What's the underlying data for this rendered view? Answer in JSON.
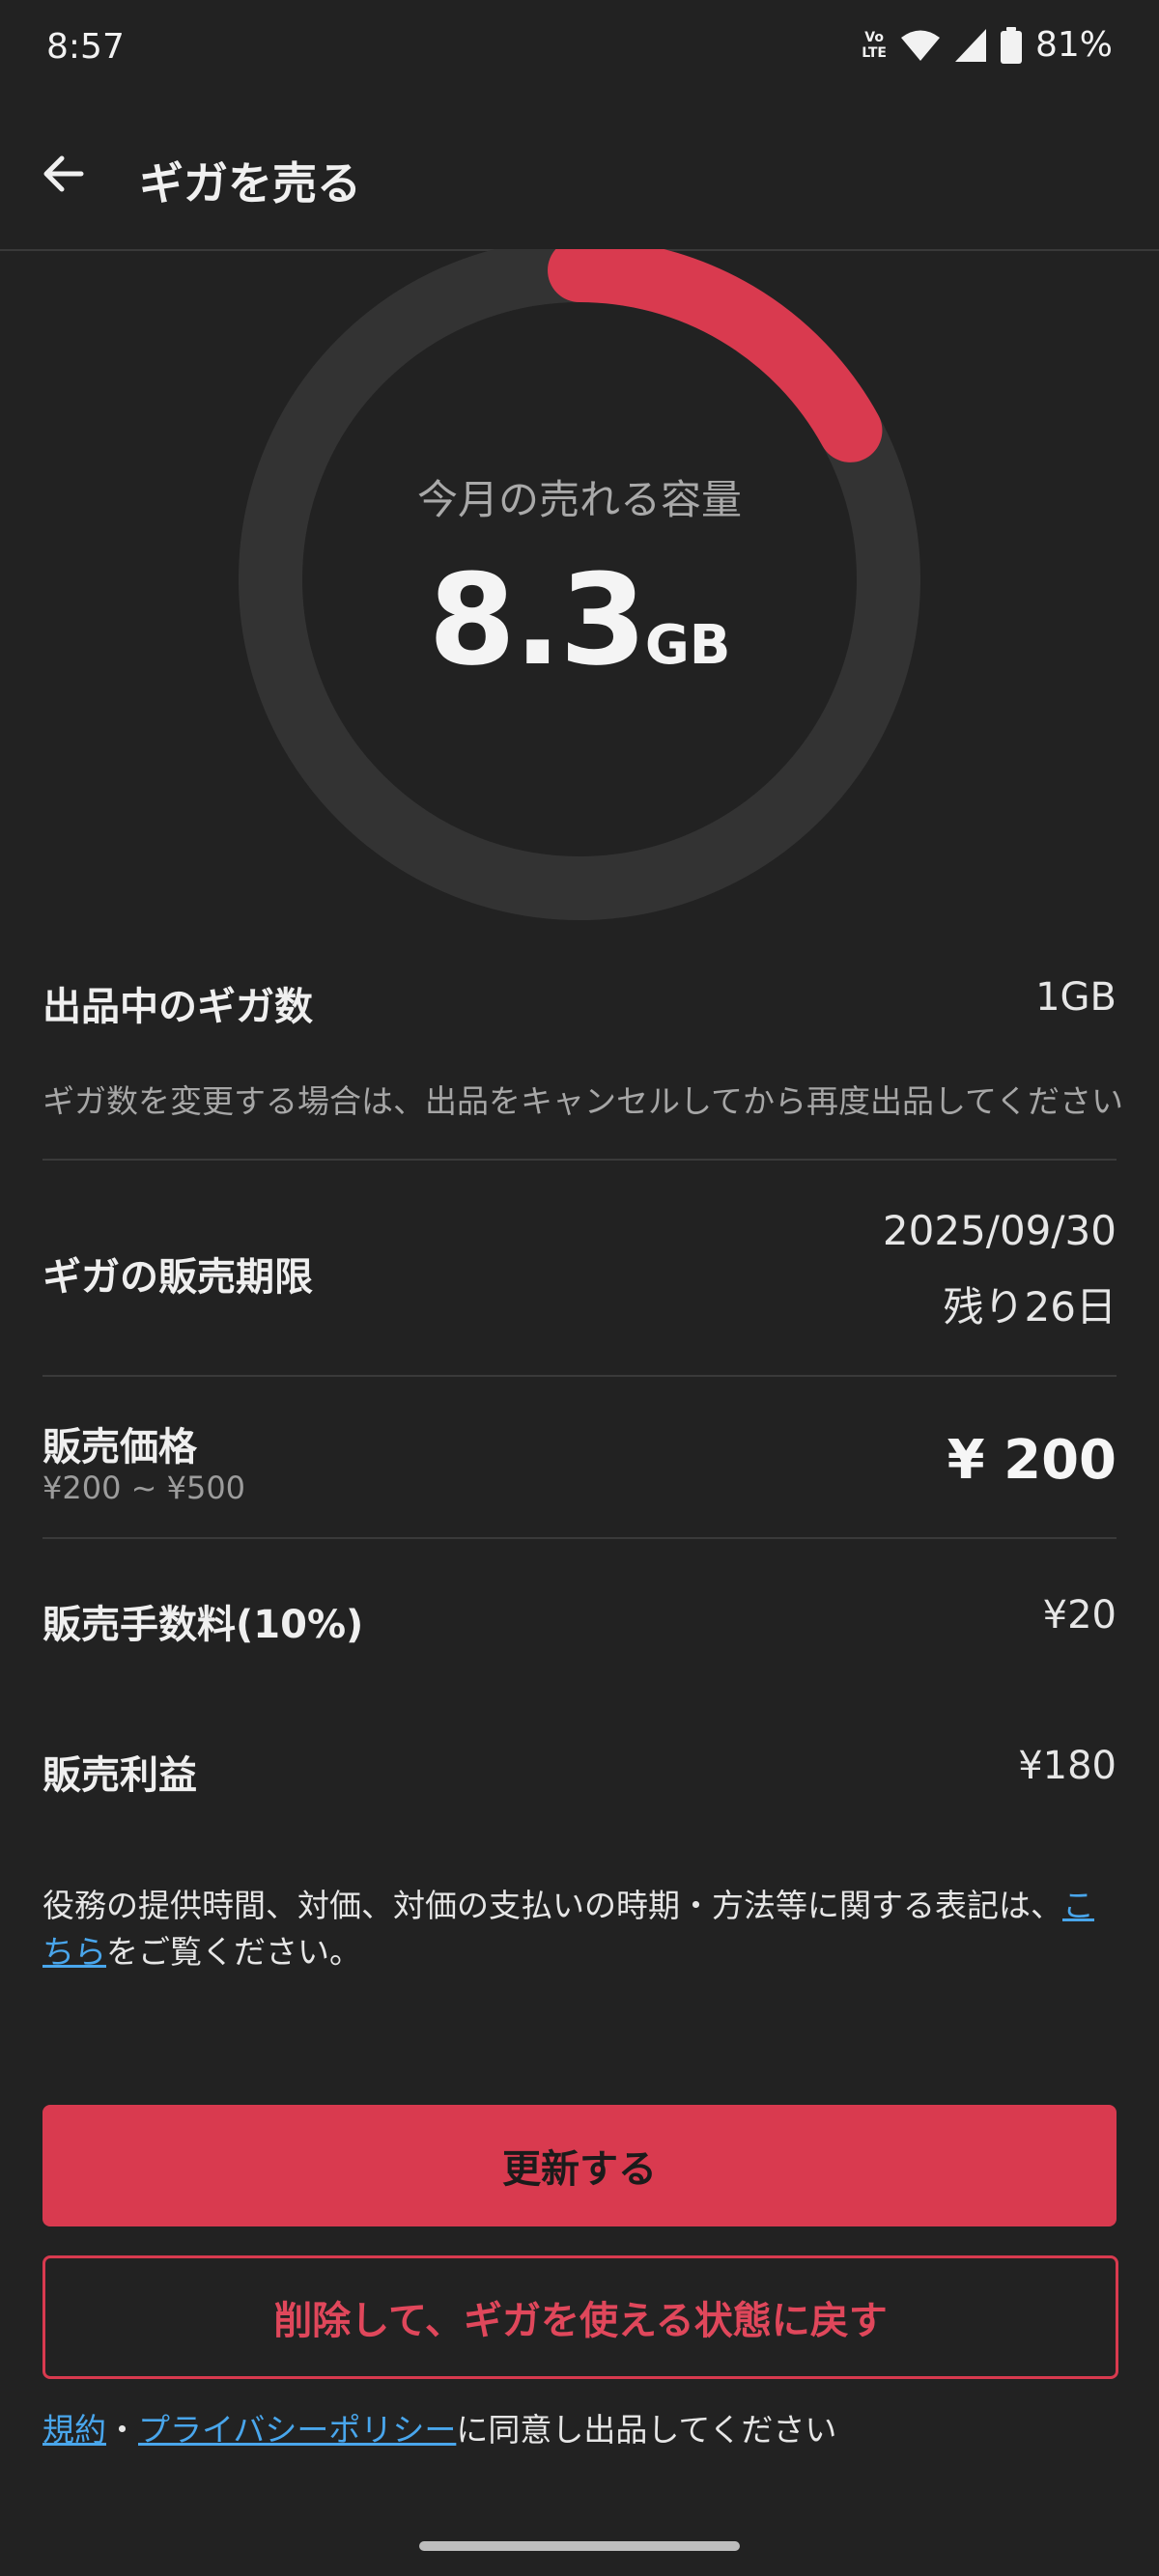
{
  "status_bar": {
    "time": "8:57",
    "volte_top": "Vo",
    "volte_bottom": "LTE",
    "battery_percent": "81%",
    "icons": [
      "volte-icon",
      "wifi-icon",
      "signal-icon",
      "battery-icon"
    ]
  },
  "header": {
    "title": "ギガを売る",
    "back_icon": "arrow-left-icon"
  },
  "gauge": {
    "label": "今月の売れる容量",
    "value": "8.3",
    "unit": "GB",
    "progress_fraction": 0.17,
    "progress_color": "#d93a4f",
    "track_color": "#333333"
  },
  "details": {
    "listing": {
      "label": "出品中のギガ数",
      "value": "1GB",
      "note": "ギガ数を変更する場合は、出品をキャンセルしてから再度出品してください"
    },
    "deadline": {
      "label": "ギガの販売期限",
      "date": "2025/09/30",
      "remaining": "残り26日"
    },
    "price": {
      "label": "販売価格",
      "range": "¥200 ~ ¥500",
      "value": "¥ 200"
    },
    "fee": {
      "label": "販売手数料(10%)",
      "value": "¥20"
    },
    "profit": {
      "label": "販売利益",
      "value": "¥180"
    }
  },
  "disclaimer": {
    "text": "役務の提供時間、対価、対価の支払いの時期・方法等に関する表記は、",
    "link": "こちら",
    "suffix": "をご覧ください。"
  },
  "buttons": {
    "update": "更新する",
    "delete": "削除して、ギガを使える状態に戻す"
  },
  "agreement": {
    "terms_link": "規約",
    "separator": "・",
    "privacy_link": "プライバシーポリシー",
    "suffix": "に同意し出品してください"
  },
  "colors": {
    "accent": "#d93a4f",
    "link": "#49a6ec",
    "background": "#222222"
  }
}
